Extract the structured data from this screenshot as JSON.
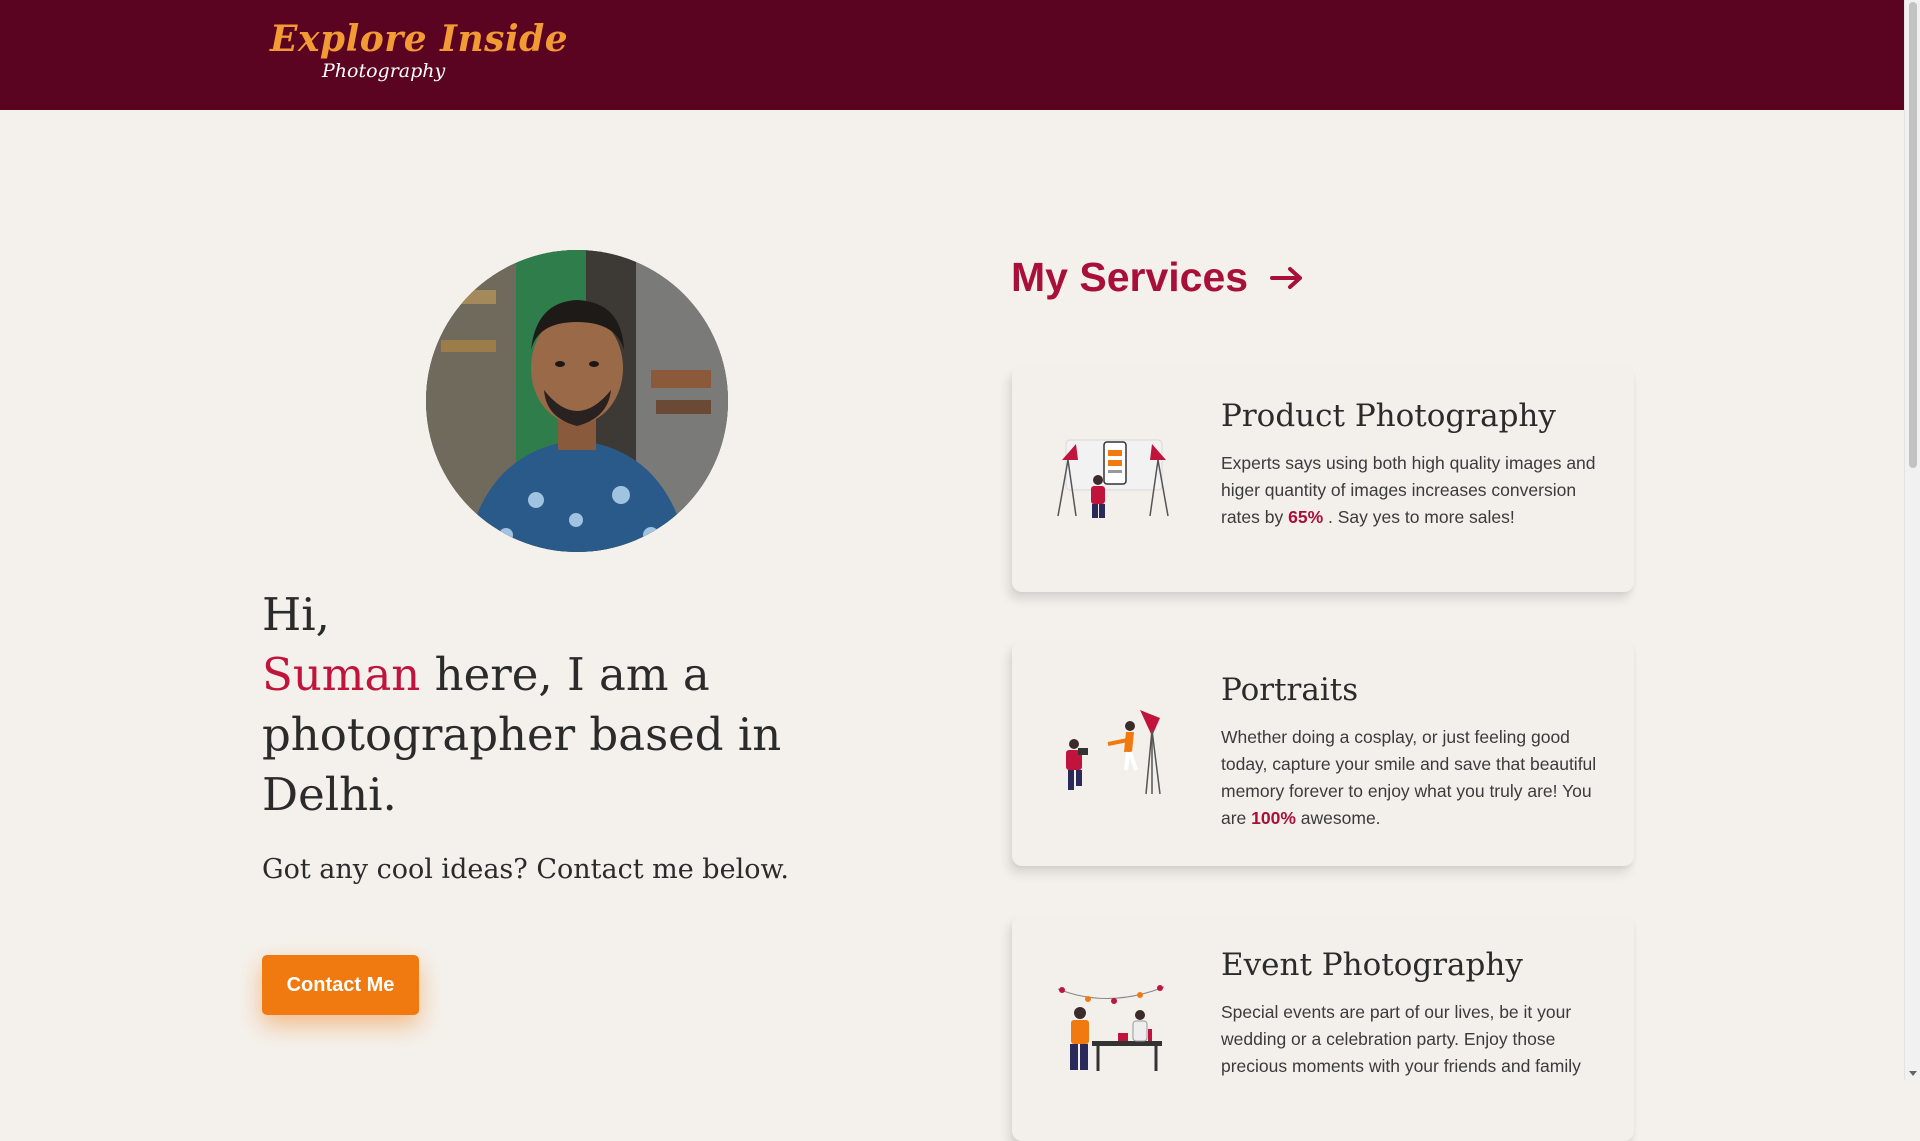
{
  "header": {
    "logo_main": "Explore Inside",
    "logo_sub": "Photography",
    "bg_color": "#5b0421",
    "logo_color": "#f29a33"
  },
  "hero": {
    "greeting": "Hi,",
    "name": "Suman",
    "intro_rest_1": " here, I am a",
    "intro_rest_2": "photographer based in",
    "intro_rest_3": "Delhi.",
    "subline": "Got any cool ideas? Contact me below.",
    "contact_button": "Contact Me",
    "accent_color": "#c0143c",
    "button_color": "#f07a10"
  },
  "services": {
    "title": "My Services",
    "title_icon": "arrow-right-icon",
    "cards": [
      {
        "title": "Product Photography",
        "desc_before": "Experts says using both high quality images and higer quantity of images increases conversion rates by ",
        "highlight": "65%",
        "desc_after": " . Say yes to more sales!",
        "icon": "product-photography-illustration"
      },
      {
        "title": "Portraits",
        "desc_before": "Whether doing a cosplay, or just feeling good today, capture your smile and save that beautiful memory forever to enjoy what you truly are! You are ",
        "highlight": "100%",
        "desc_after": " awesome.",
        "icon": "portrait-photography-illustration"
      },
      {
        "title": "Event Photography",
        "desc_before": "Special events are part of our lives, be it your wedding or a celebration party. Enjoy those precious moments with your friends and family",
        "highlight": "",
        "desc_after": "",
        "icon": "event-photography-illustration"
      }
    ]
  }
}
